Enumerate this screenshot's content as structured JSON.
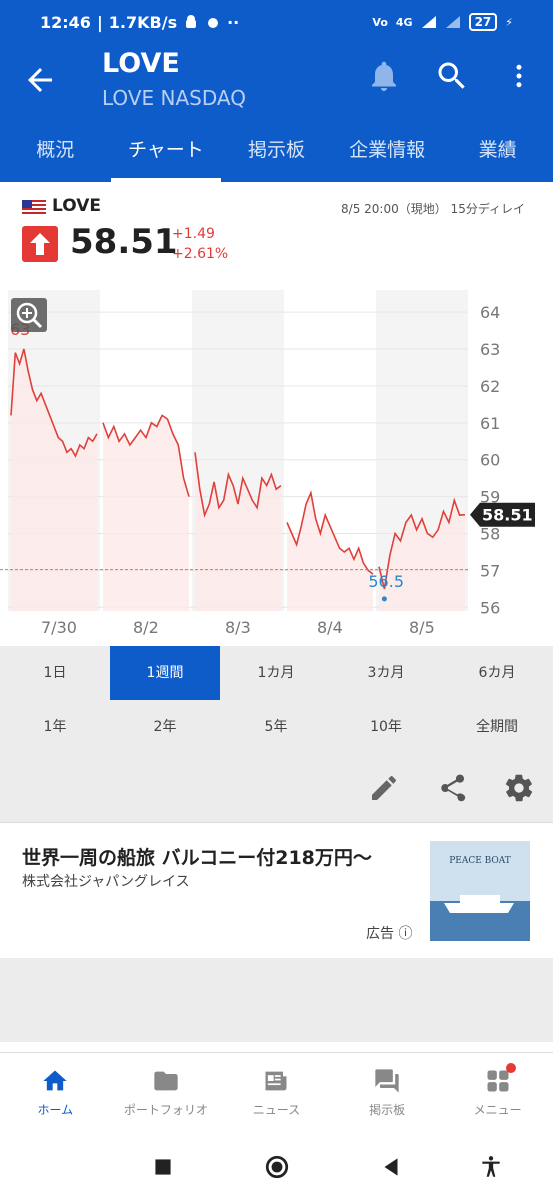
{
  "status": {
    "time": "12:46",
    "speed": "1.7KB/s",
    "battery": "27",
    "network": "4G"
  },
  "appbar": {
    "title": "LOVE",
    "subtitle": "LOVE NASDAQ"
  },
  "tabs": [
    "概況",
    "チャート",
    "掲示板",
    "企業情報",
    "業績"
  ],
  "quote": {
    "symbol": "LOVE",
    "time": "8/5 20:00（現地）  15分ディレイ",
    "price": "58.51",
    "change": "+1.49",
    "change_pct": "+2.61%"
  },
  "chart_data": {
    "type": "line",
    "x_labels": [
      "7/30",
      "8/2",
      "8/3",
      "8/4",
      "8/5"
    ],
    "y_ticks": [
      64,
      63,
      62,
      61,
      60,
      59,
      58,
      57,
      56
    ],
    "ylim": [
      55.9,
      64.6
    ],
    "last_price": 58.51,
    "high_label": "63",
    "low_label": "56.5",
    "reference_line": 57.02,
    "series": [
      {
        "values": [
          61.2,
          62.9,
          62.6,
          63.0,
          62.4,
          61.9,
          61.6,
          61.8,
          61.5,
          61.2,
          60.9,
          60.6,
          60.5,
          60.2,
          60.3,
          60.1,
          60.4,
          60.3,
          60.6,
          60.5,
          60.7
        ]
      },
      {
        "values": [
          61.0,
          60.6,
          60.9,
          60.5,
          60.7,
          60.4,
          60.6,
          60.8,
          60.6,
          61.0,
          60.9,
          61.2,
          61.1,
          60.7,
          60.4,
          59.5,
          59.0
        ]
      },
      {
        "values": [
          60.2,
          59.2,
          58.5,
          58.8,
          59.4,
          58.7,
          58.9,
          59.6,
          59.3,
          58.8,
          59.5,
          59.2,
          58.9,
          58.7,
          59.5,
          59.3,
          59.6,
          59.2,
          59.3
        ]
      },
      {
        "values": [
          58.3,
          58.0,
          57.7,
          58.2,
          58.8,
          59.1,
          58.4,
          58.0,
          58.5,
          58.2,
          57.9,
          57.6,
          57.5,
          57.6,
          57.3,
          57.6,
          57.2,
          57.0,
          56.9
        ]
      },
      {
        "values": [
          57.1,
          56.5,
          57.4,
          58.0,
          57.8,
          58.3,
          58.5,
          58.1,
          58.4,
          58.0,
          57.9,
          58.1,
          58.6,
          58.3,
          58.9,
          58.5,
          58.51
        ]
      }
    ],
    "colors": {
      "line": "#e0403a",
      "fill": "#fde9e8",
      "shade": "#f4f4f4",
      "ref": "#e07b20"
    }
  },
  "ranges": [
    "1日",
    "1週間",
    "1カ月",
    "3カ月",
    "6カ月",
    "1年",
    "2年",
    "5年",
    "10年",
    "全期間"
  ],
  "active_range": "1週間",
  "ad": {
    "headline": "世界一周の船旅 バルコニー付218万円〜",
    "company": "株式会社ジャパングレイス",
    "label": "広告",
    "thumb_text": "PEACE BOAT"
  },
  "bottom_nav": [
    "ホーム",
    "ポートフォリオ",
    "ニュース",
    "掲示板",
    "メニュー"
  ]
}
